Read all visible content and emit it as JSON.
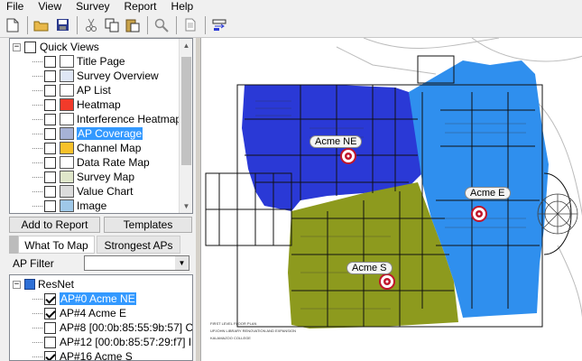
{
  "menu": [
    "File",
    "View",
    "Survey",
    "Report",
    "Help"
  ],
  "toolbar": [
    "new-icon",
    "open-icon",
    "save-icon",
    "cut-icon",
    "copy-icon",
    "paste-icon",
    "zoom-icon",
    "page-icon",
    "export-icon"
  ],
  "quick_views": {
    "root_label": "Quick Views",
    "items": [
      {
        "label": "Title Page",
        "icon": "title-page-icon",
        "checked": false,
        "selected": false
      },
      {
        "label": "Survey Overview",
        "icon": "survey-overview-icon",
        "checked": false,
        "selected": false
      },
      {
        "label": "AP List",
        "icon": "ap-list-icon",
        "checked": false,
        "selected": false
      },
      {
        "label": "Heatmap",
        "icon": "heatmap-icon",
        "checked": false,
        "selected": false
      },
      {
        "label": "Interference Heatmap",
        "icon": "interference-heatmap-icon",
        "checked": false,
        "selected": false
      },
      {
        "label": "AP Coverage",
        "icon": "ap-coverage-icon",
        "checked": false,
        "selected": true
      },
      {
        "label": "Channel Map",
        "icon": "channel-map-icon",
        "checked": false,
        "selected": false
      },
      {
        "label": "Data Rate Map",
        "icon": "data-rate-map-icon",
        "checked": false,
        "selected": false
      },
      {
        "label": "Survey Map",
        "icon": "survey-map-icon",
        "checked": false,
        "selected": false
      },
      {
        "label": "Value Chart",
        "icon": "value-chart-icon",
        "checked": false,
        "selected": false
      },
      {
        "label": "Image",
        "icon": "image-icon",
        "checked": false,
        "selected": false
      }
    ]
  },
  "buttons": {
    "add_to_report": "Add to Report",
    "templates": "Templates"
  },
  "tabs": {
    "what_to_map": "What To Map",
    "strongest_aps": "Strongest APs"
  },
  "ap_filter": {
    "label": "AP Filter",
    "value": ""
  },
  "ap_tree": {
    "root_label": "ResNet",
    "items": [
      {
        "label": "AP#0 Acme NE",
        "checked": true,
        "selected": true
      },
      {
        "label": "AP#4 Acme E",
        "checked": true,
        "selected": false
      },
      {
        "label": "AP#8 [00:0b:85:55:9b:57] C",
        "checked": false,
        "selected": false
      },
      {
        "label": "AP#12 [00:0b:85:57:29:f7] I",
        "checked": false,
        "selected": false
      },
      {
        "label": "AP#16 Acme S",
        "checked": true,
        "selected": false
      }
    ]
  },
  "map": {
    "aps": [
      {
        "label": "Acme NE",
        "color": "#2a39d6"
      },
      {
        "label": "Acme E",
        "color": "#2f8fee"
      },
      {
        "label": "Acme S",
        "color": "#8d9a1e"
      }
    ],
    "footer": [
      "FIRST LEVEL FLOOR PLAN",
      "UPJOHN LIBRARY RENOVATION AND EXPANSION",
      "KALAMAZOO COLLEGE"
    ]
  },
  "colors": {
    "selection": "#3399ff",
    "ne_coverage": "#2a39d6",
    "e_coverage": "#2f8fee",
    "s_coverage": "#8d9a1e"
  }
}
